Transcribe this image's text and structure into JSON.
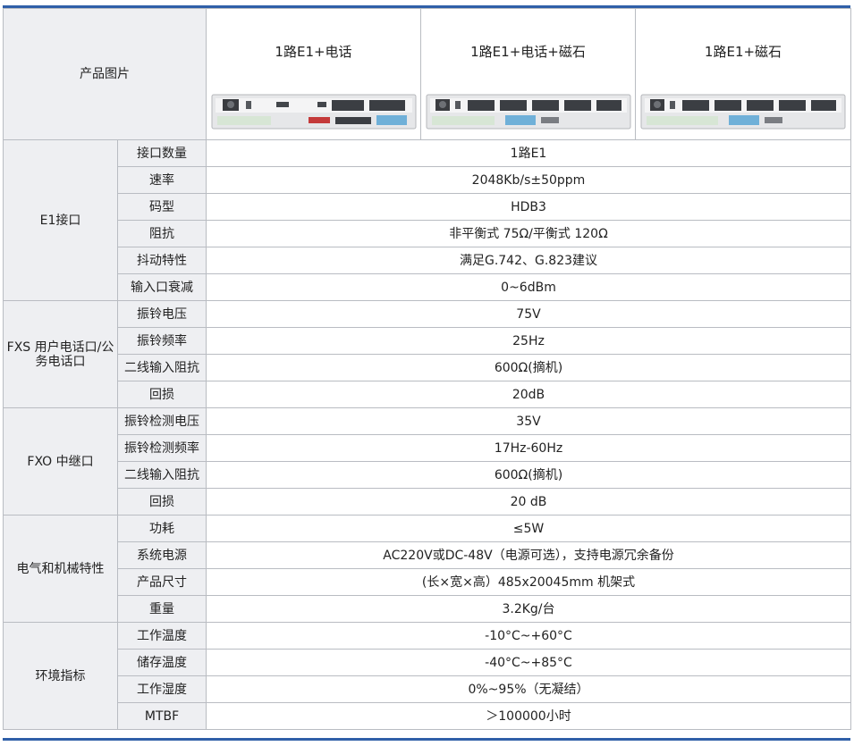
{
  "header": {
    "label": "产品图片",
    "products": [
      "1路E1+电话",
      "1路E1+电话+磁石",
      "1路E1+磁石"
    ]
  },
  "groups": [
    {
      "name": "E1接口",
      "rows": [
        {
          "label": "接口数量",
          "value": "1路E1"
        },
        {
          "label": "速率",
          "value": "2048Kb/s±50ppm"
        },
        {
          "label": "码型",
          "value": "HDB3"
        },
        {
          "label": "阻抗",
          "value": "非平衡式 75Ω/平衡式 120Ω"
        },
        {
          "label": "抖动特性",
          "value": "满足G.742、G.823建议"
        },
        {
          "label": "输入口衰减",
          "value": "0~6dBm"
        }
      ]
    },
    {
      "name": "FXS 用户电话口/公务电话口",
      "rows": [
        {
          "label": "振铃电压",
          "value": "75V"
        },
        {
          "label": "振铃频率",
          "value": "25Hz"
        },
        {
          "label": "二线输入阻抗",
          "value": "600Ω(摘机)"
        },
        {
          "label": "回损",
          "value": "20dB"
        }
      ]
    },
    {
      "name": "FXO 中继口",
      "rows": [
        {
          "label": "振铃检测电压",
          "value": "35V"
        },
        {
          "label": "振铃检测频率",
          "value": "17Hz-60Hz"
        },
        {
          "label": "二线输入阻抗",
          "value": "600Ω(摘机)"
        },
        {
          "label": "回损",
          "value": "20 dB"
        }
      ]
    },
    {
      "name": "电气和机械特性",
      "rows": [
        {
          "label": "功耗",
          "value": "≤5W"
        },
        {
          "label": "系统电源",
          "value": "AC220V或DC-48V（电源可选），支持电源冗余备份"
        },
        {
          "label": "产品尺寸",
          "value": "(长×宽×高）485x20045mm 机架式"
        },
        {
          "label": "重量",
          "value": "3.2Kg/台"
        }
      ]
    },
    {
      "name": "环境指标",
      "rows": [
        {
          "label": "工作温度",
          "value": "-10°C~+60°C"
        },
        {
          "label": "储存温度",
          "value": "-40°C~+85°C"
        },
        {
          "label": "工作湿度",
          "value": "0%~95%（无凝结）"
        },
        {
          "label": "MTBF",
          "value": "＞100000小时"
        }
      ]
    }
  ],
  "colors": {
    "accent": "#2f5fa8",
    "label_bg": "#eeeff2",
    "border": "#b9bcc2"
  }
}
